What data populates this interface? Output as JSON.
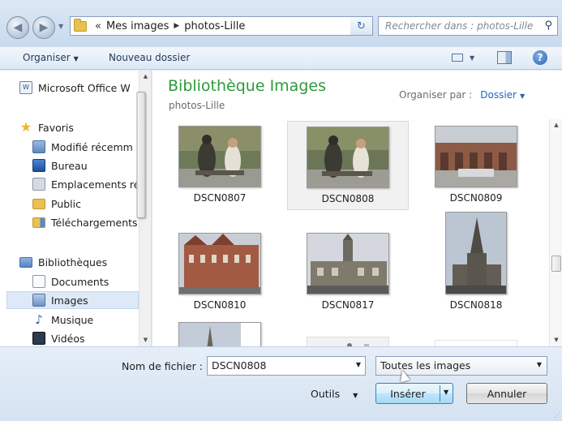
{
  "address": {
    "chevron": "«",
    "crumbs": [
      "Mes images",
      "photos-Lille"
    ],
    "search_placeholder": "Rechercher dans : photos-Lille"
  },
  "toolbar": {
    "organize": "Organiser",
    "new_folder": "Nouveau dossier"
  },
  "nav": {
    "items": [
      {
        "label": "Microsoft Office W",
        "icon": "office-icon"
      },
      {
        "label": "Favoris",
        "icon": "star-icon"
      },
      {
        "label": "Modifié récemm",
        "icon": "recent-icon"
      },
      {
        "label": "Bureau",
        "icon": "desktop-icon"
      },
      {
        "label": "Emplacements ré",
        "icon": "places-icon"
      },
      {
        "label": "Public",
        "icon": "folder-icon"
      },
      {
        "label": "Téléchargements",
        "icon": "downloads-icon"
      },
      {
        "label": "Bibliothèques",
        "icon": "libraries-icon"
      },
      {
        "label": "Documents",
        "icon": "documents-icon"
      },
      {
        "label": "Images",
        "icon": "pictures-icon",
        "selected": true
      },
      {
        "label": "Musique",
        "icon": "music-icon"
      },
      {
        "label": "Vidéos",
        "icon": "videos-icon"
      }
    ]
  },
  "library": {
    "title": "Bibliothèque Images",
    "subtitle": "photos-Lille",
    "arrange_label": "Organiser par :",
    "arrange_value": "Dossier"
  },
  "files": [
    {
      "name": "DSCN0807",
      "selected": false
    },
    {
      "name": "DSCN0808",
      "selected": true
    },
    {
      "name": "DSCN0809",
      "selected": false
    },
    {
      "name": "DSCN0810",
      "selected": false
    },
    {
      "name": "DSCN0817",
      "selected": false
    },
    {
      "name": "DSCN0818",
      "selected": false
    }
  ],
  "footer": {
    "filename_label": "Nom de fichier :",
    "filename_value": "DSCN0808",
    "filetype_value": "Toutes les images",
    "tools_label": "Outils",
    "insert_label": "Insérer",
    "cancel_label": "Annuler"
  },
  "colors": {
    "library_title": "#2e9a3a",
    "link_blue": "#2266bb",
    "selection_bg": "#dde9f7"
  }
}
